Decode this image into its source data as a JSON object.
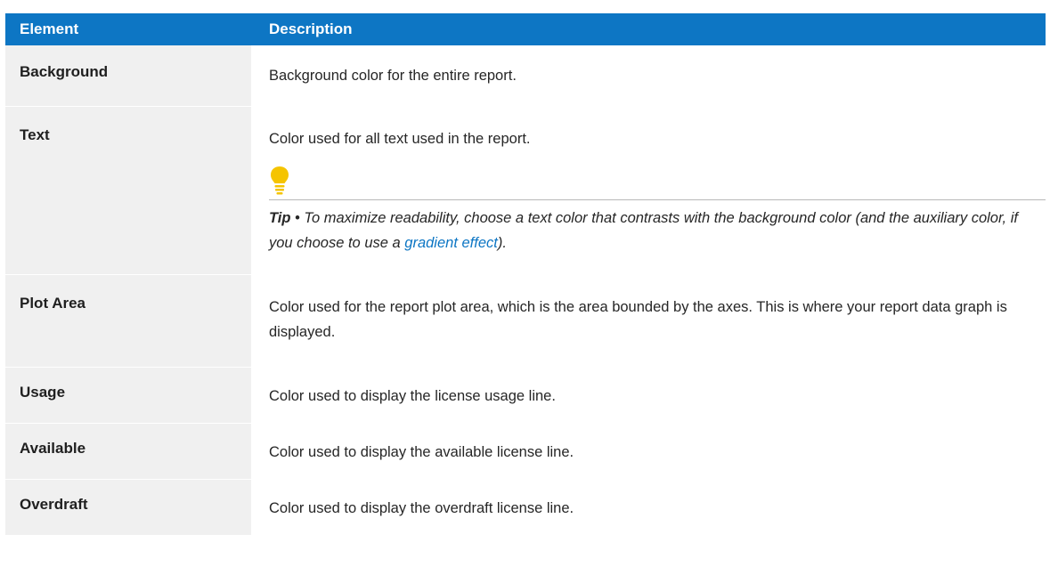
{
  "table": {
    "header": {
      "element": "Element",
      "description": "Description"
    },
    "rows": [
      {
        "element": "Background",
        "description": "Background color for the entire report."
      },
      {
        "element": "Text",
        "description": "Color used for all text used in the report."
      },
      {
        "element": "Plot Area",
        "description": "Color used for the report plot area, which is the area bounded by the axes. This is where your report data graph is displayed."
      },
      {
        "element": "Usage",
        "description": "Color used to display the license usage line."
      },
      {
        "element": "Available",
        "description": "Color used to display the available license line."
      },
      {
        "element": "Overdraft",
        "description": "Color used to display the overdraft license line."
      }
    ]
  },
  "tip": {
    "icon": "lightbulb-icon",
    "label": "Tip",
    "separator": " • ",
    "text_before": "To maximize readability, choose a text color that contrasts with the background color (and the auxiliary color, if you choose to use a ",
    "link_text": "gradient effect",
    "text_after": ")."
  },
  "colors": {
    "header_bg": "#0d76c4",
    "first_col_bg": "#f0f0f0",
    "link": "#0d76c4",
    "bulb": "#f5c400"
  }
}
